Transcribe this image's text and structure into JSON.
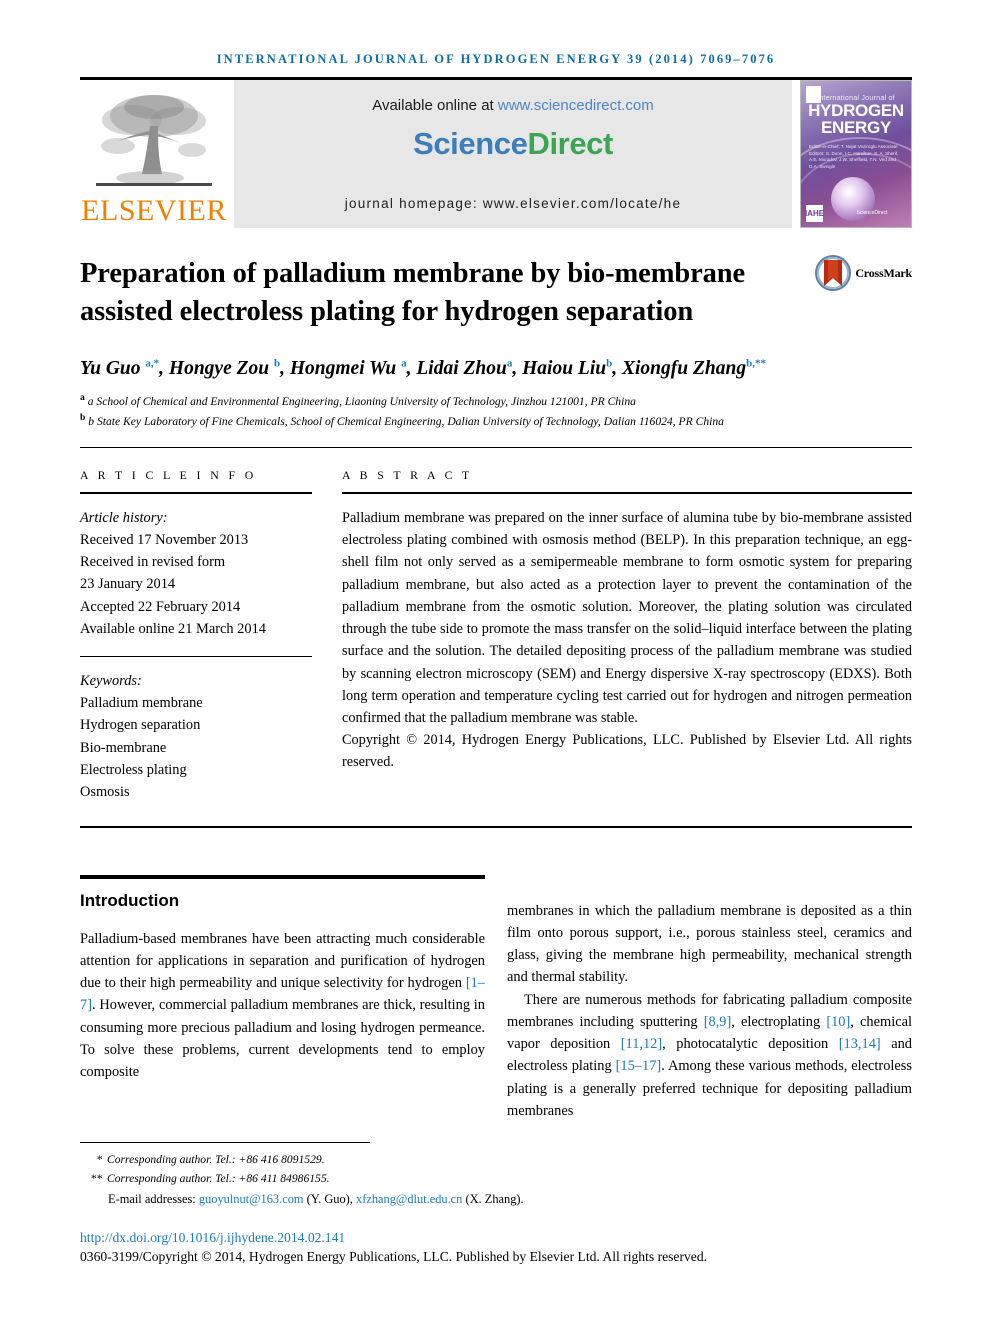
{
  "running_head": "INTERNATIONAL JOURNAL OF HYDROGEN ENERGY 39 (2014) 7069–7076",
  "masthead": {
    "publisher_logo_text": "ELSEVIER",
    "publisher_logo_icon": "elsevier-tree-icon",
    "available_prefix": "Available online at ",
    "available_url": "www.sciencedirect.com",
    "sciencedirect_part1": "Science",
    "sciencedirect_part2": "Direct",
    "journal_homepage": "journal homepage: www.elsevier.com/locate/he",
    "cover": {
      "line1": "International Journal of",
      "line2": "HYDROGEN",
      "line3": "ENERGY",
      "editors": "Editor-in-Chief:  T. Nejat Veziroglu\nAssociate Editors:  S. Dunn, I.C. Hamilton, S. A. Sherif,\nA.E. Muradov, J.W. Sheffield,\nT.N. Ved  and D.A. Swingle",
      "badge_left": "IAHE",
      "badge_top": "IAHE",
      "sciencedirect_mark": "ScienceDirect"
    }
  },
  "crossmark": {
    "label": "CrossMark",
    "icon": "crossmark-icon"
  },
  "title": "Preparation of palladium membrane by bio-membrane assisted electroless plating for hydrogen separation",
  "authors_html": "Yu Guo <sup>a,*</sup>, Hongye Zou <sup>b</sup>, Hongmei Wu <sup>a</sup>, Lidai Zhou<sup>a</sup>, Haiou Liu<sup>b</sup>, Xiongfu Zhang<sup>b,**</sup>",
  "affiliations": [
    "a School of Chemical and Environmental Engineering, Liaoning University of Technology, Jinzhou 121001, PR China",
    "b State Key Laboratory of Fine Chemicals, School of Chemical Engineering, Dalian University of Technology, Dalian 116024, PR China"
  ],
  "article_info": {
    "heading": "A R T I C L E   I N F O",
    "history_label": "Article history:",
    "history": [
      "Received 17 November 2013",
      "Received in revised form",
      "23 January 2014",
      "Accepted 22 February 2014",
      "Available online 21 March 2014"
    ],
    "keywords_label": "Keywords:",
    "keywords": [
      "Palladium membrane",
      "Hydrogen separation",
      "Bio-membrane",
      "Electroless plating",
      "Osmosis"
    ]
  },
  "abstract": {
    "heading": "A B S T R A C T",
    "text": "Palladium membrane was prepared on the inner surface of alumina tube by bio-membrane assisted electroless plating combined with osmosis method (BELP). In this preparation technique, an egg-shell film not only served as a semipermeable membrane to form osmotic system for preparing palladium membrane, but also acted as a protection layer to prevent the contamination of the palladium membrane from the osmotic solution. Moreover, the plating solution was circulated through the tube side to promote the mass transfer on the solid–liquid interface between the plating surface and the solution. The detailed depositing process of the palladium membrane was studied by scanning electron microscopy (SEM) and Energy dispersive X-ray spectroscopy (EDXS). Both long term operation and temperature cycling test carried out for hydrogen and nitrogen permeation confirmed that the palladium membrane was stable.",
    "copyright": "Copyright © 2014, Hydrogen Energy Publications, LLC. Published by Elsevier Ltd. All rights reserved."
  },
  "introduction": {
    "heading": "Introduction",
    "left_paragraph_html": "Palladium-based membranes have been attracting much considerable attention for applications in separation and purification of hydrogen due to their high permeability and unique selectivity for hydrogen <span class=\"ref\">[1–7]</span>. However, commercial palladium membranes are thick, resulting in consuming more precious palladium and losing hydrogen permeance. To solve these problems, current developments tend to employ composite",
    "right_paragraph1_html": "membranes in which the palladium membrane is deposited as a thin film onto porous support, i.e., porous stainless steel, ceramics and glass, giving the membrane high permeability, mechanical strength and thermal stability.",
    "right_paragraph2_html": "There are numerous methods for fabricating palladium composite membranes including sputtering <span class=\"ref\">[8,9]</span>, electroplating <span class=\"ref\">[10]</span>, chemical vapor deposition <span class=\"ref\">[11,12]</span>, photocatalytic deposition <span class=\"ref\">[13,14]</span> and electroless plating <span class=\"ref\">[15–17]</span>. Among these various methods, electroless plating is a generally preferred technique for depositing palladium membranes"
  },
  "footer": {
    "corresponding1": "Corresponding author. Tel.: +86 416 8091529.",
    "corresponding1_marker": "*",
    "corresponding2": "Corresponding author. Tel.: +86 411 84986155.",
    "corresponding2_marker": "**",
    "email_label": "E-mail addresses:",
    "email1": "guoyulnut@163.com",
    "email1_owner": "(Y. Guo),",
    "email2": "xfzhang@dlut.edu.cn",
    "email2_owner": "(X. Zhang).",
    "doi": "http://dx.doi.org/10.1016/j.ijhydene.2014.02.141",
    "issn_line": "0360-3199/Copyright © 2014, Hydrogen Energy Publications, LLC. Published by Elsevier Ltd. All rights reserved."
  },
  "colors": {
    "link": "#1b7bb5",
    "runhead": "#0d6ea1",
    "elsevier_orange": "#f08000",
    "sd_blue": "#3b7dbd",
    "sd_green": "#3aa652"
  }
}
